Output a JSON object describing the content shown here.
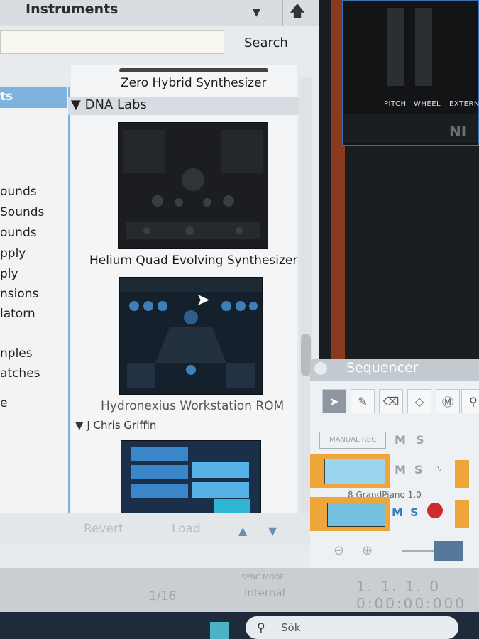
{
  "browser": {
    "title": "Instruments",
    "search_placeholder": "",
    "search_label": "Search",
    "categories": [
      "ts",
      "ounds",
      "Sounds",
      "ounds",
      "pply",
      "ply",
      "nsions",
      "latorn",
      "nples",
      "atches",
      "e"
    ],
    "header_item": "Zero Hybrid Synthesizer",
    "groups": [
      {
        "name": "DNA Labs",
        "items": [
          "Helium Quad Evolving Synthesizer",
          "Hydronexius Workstation ROM"
        ]
      },
      {
        "name": "J Chris Griffin",
        "items": [
          ""
        ]
      }
    ],
    "bottom": {
      "revert": "Revert",
      "load": "Load"
    }
  },
  "rack": {
    "labels": [
      "PITCH",
      "WHEEL",
      "EXTERN",
      "NI"
    ]
  },
  "sequencer": {
    "title": "Sequencer",
    "manual_rec": "MANUAL REC",
    "mute": "M",
    "solo": "S",
    "track_name": "8 GrandPiano 1.0"
  },
  "transport": {
    "sync_mode_label": "SYNC MODE",
    "sync_mode_value": "Internal",
    "signature": "1/16",
    "position": "1.  1.  1.    0",
    "time": "0:00:00:000"
  },
  "taskbar": {
    "search_text": "Sök"
  },
  "colors": {
    "accent": "#7fb3df",
    "clip": "#f0a53a",
    "rack_border": "#3a6fb0"
  }
}
